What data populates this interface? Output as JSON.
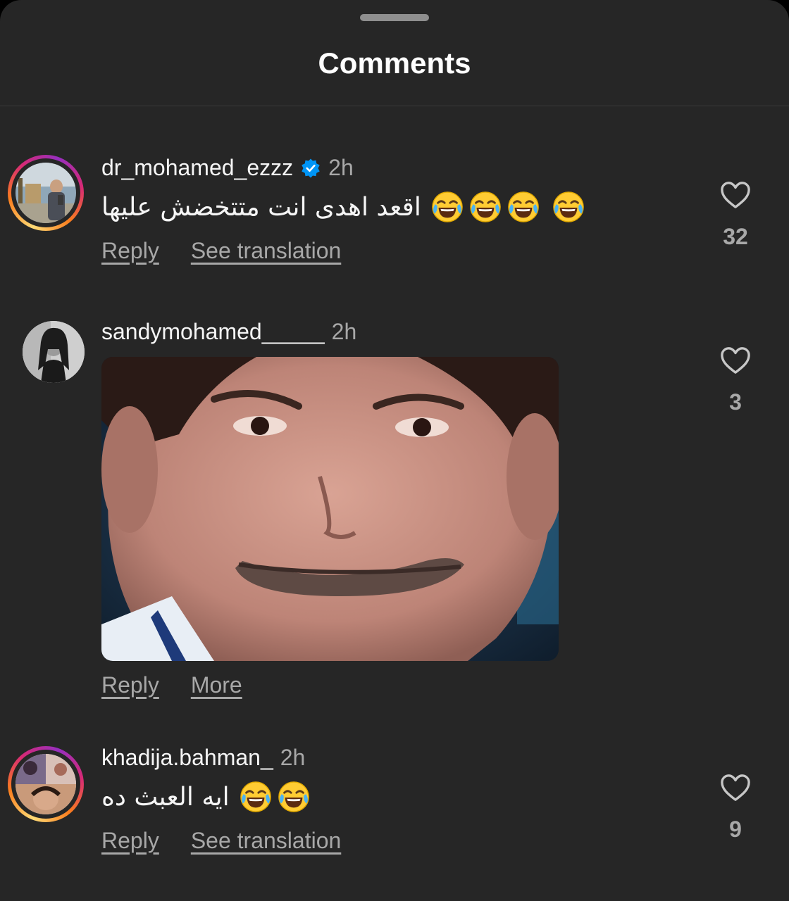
{
  "header": {
    "title": "Comments"
  },
  "comments": [
    {
      "username": "dr_mohamed_ezzz",
      "verified": true,
      "time": "2h",
      "text": "اقعد اهدى انت متتخضش عليها",
      "emoji_count": 4,
      "actions": [
        "Reply",
        "See translation"
      ],
      "likes": "32"
    },
    {
      "username": "sandymohamed_____",
      "verified": false,
      "time": "2h",
      "media": "gif-smiling-face",
      "actions": [
        "Reply",
        "More"
      ],
      "likes": "3"
    },
    {
      "username": "khadija.bahman_",
      "verified": false,
      "time": "2h",
      "text": "ايه العبث ده",
      "emoji_count": 2,
      "actions": [
        "Reply",
        "See translation"
      ],
      "likes": "9"
    }
  ],
  "icons": {
    "verified": "verified-badge-icon",
    "heart": "heart-outline-icon",
    "emoji": "face-with-tears-of-joy-icon"
  },
  "colors": {
    "background": "#262626",
    "text_primary": "#f5f5f5",
    "text_secondary": "#a8a8a8",
    "verified_blue": "#0095f6"
  }
}
